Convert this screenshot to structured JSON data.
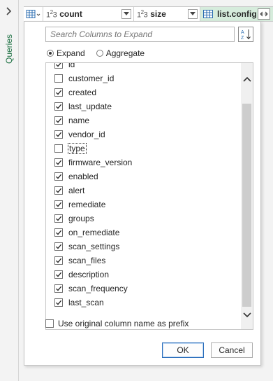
{
  "side_pane": {
    "label": "Queries",
    "chevron_icon": "chevron-right-icon"
  },
  "header": {
    "columns": [
      {
        "type_label": "123",
        "name": "count"
      },
      {
        "type_label": "123",
        "name": "size"
      },
      {
        "name": "list.config"
      }
    ]
  },
  "panel": {
    "search_placeholder": "Search Columns to Expand",
    "radio": {
      "expand_label": "Expand",
      "aggregate_label": "Aggregate",
      "selected": "Expand"
    },
    "items": [
      {
        "label": "id",
        "checked": true
      },
      {
        "label": "customer_id",
        "checked": false
      },
      {
        "label": "created",
        "checked": true
      },
      {
        "label": "last_update",
        "checked": true
      },
      {
        "label": "name",
        "checked": true
      },
      {
        "label": "vendor_id",
        "checked": true
      },
      {
        "label": "type",
        "checked": false
      },
      {
        "label": "firmware_version",
        "checked": true
      },
      {
        "label": "enabled",
        "checked": true
      },
      {
        "label": "alert",
        "checked": true
      },
      {
        "label": "remediate",
        "checked": true
      },
      {
        "label": "groups",
        "checked": true
      },
      {
        "label": "on_remediate",
        "checked": true
      },
      {
        "label": "scan_settings",
        "checked": true
      },
      {
        "label": "scan_files",
        "checked": true
      },
      {
        "label": "description",
        "checked": true
      },
      {
        "label": "scan_frequency",
        "checked": true
      },
      {
        "label": "last_scan",
        "checked": true
      }
    ],
    "prefix_label": "Use original column name as prefix",
    "prefix_checked": false,
    "ok_label": "OK",
    "cancel_label": "Cancel"
  },
  "colors": {
    "accent_green": "#217346",
    "selected_column_bg": "#d6ecdc",
    "ok_border": "#2a6ebb"
  }
}
